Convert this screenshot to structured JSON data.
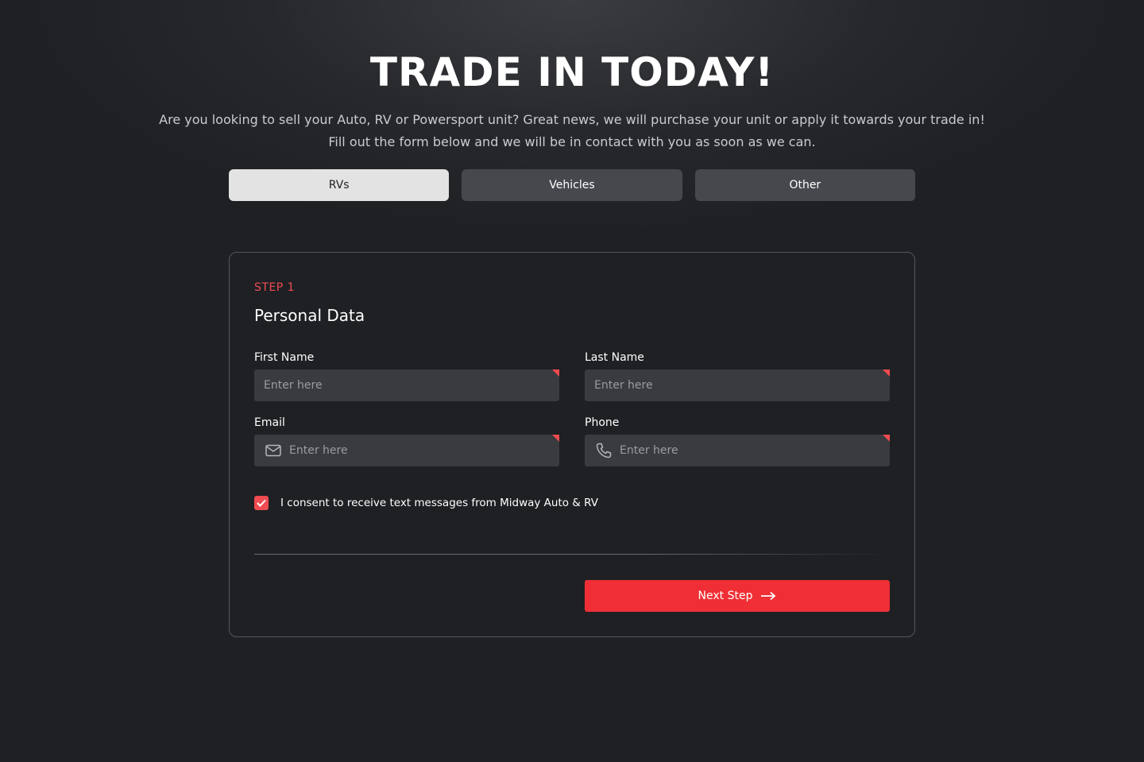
{
  "hero": {
    "title": "TRADE IN TODAY!",
    "subtitle_line1": "Are you looking to sell your Auto, RV or Powersport unit? Great news, we will purchase your unit or apply it towards your trade in!",
    "subtitle_line2": "Fill out the form below and we will be in contact with you as soon as we can."
  },
  "tabs": [
    {
      "label": "RVs",
      "active": true
    },
    {
      "label": "Vehicles",
      "active": false
    },
    {
      "label": "Other",
      "active": false
    }
  ],
  "form": {
    "step_label": "STEP 1",
    "section_title": "Personal Data",
    "fields": {
      "first_name": {
        "label": "First Name",
        "placeholder": "Enter here",
        "value": ""
      },
      "last_name": {
        "label": "Last Name",
        "placeholder": "Enter here",
        "value": ""
      },
      "email": {
        "label": "Email",
        "placeholder": "Enter here",
        "value": "",
        "icon": "envelope-icon"
      },
      "phone": {
        "label": "Phone",
        "placeholder": "Enter here",
        "value": "",
        "icon": "phone-icon"
      }
    },
    "consent": {
      "checked": true,
      "label": "I consent to receive text messages from Midway Auto & RV"
    },
    "next_button": {
      "label": "Next Step",
      "icon": "arrow-right-icon"
    }
  },
  "colors": {
    "accent": "#ef2f35",
    "step_label": "#ef4b50",
    "background": "#1e2024",
    "input_bg": "#3a3b3f",
    "tab_active": "#e3e3e3",
    "tab_inactive": "#46484d"
  }
}
